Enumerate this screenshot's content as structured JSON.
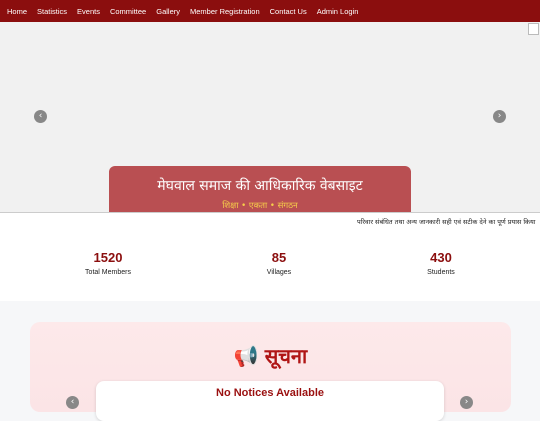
{
  "nav": {
    "items": [
      "Home",
      "Statistics",
      "Events",
      "Committee",
      "Gallery",
      "Member Registration",
      "Contact Us",
      "Admin Login"
    ]
  },
  "carousel": {
    "prev_icon": "‹",
    "next_icon": "›",
    "caption_title": "मेघवाल समाज की आधिकारिक वेबसाइट",
    "caption_subtitle": "शिक्षा • एकता • संगठन"
  },
  "ticker": {
    "text": "परिवार संबंधित तथा अन्य जानकारी सही एवं सटीक देने का पूर्ण प्रयास किया"
  },
  "stats": [
    {
      "value": "1520",
      "label": "Total Members"
    },
    {
      "value": "85",
      "label": "Villages"
    },
    {
      "value": "430",
      "label": "Students"
    }
  ],
  "notices": {
    "icon": "📢",
    "title": "सूचना",
    "empty_message": "No Notices Available",
    "prev_icon": "‹",
    "next_icon": "›"
  },
  "colors": {
    "nav_bg": "#8b0e0e",
    "caption_bg": "#b94f52",
    "caption_subtitle": "#f6cf4a",
    "accent": "#8b0e0e"
  }
}
